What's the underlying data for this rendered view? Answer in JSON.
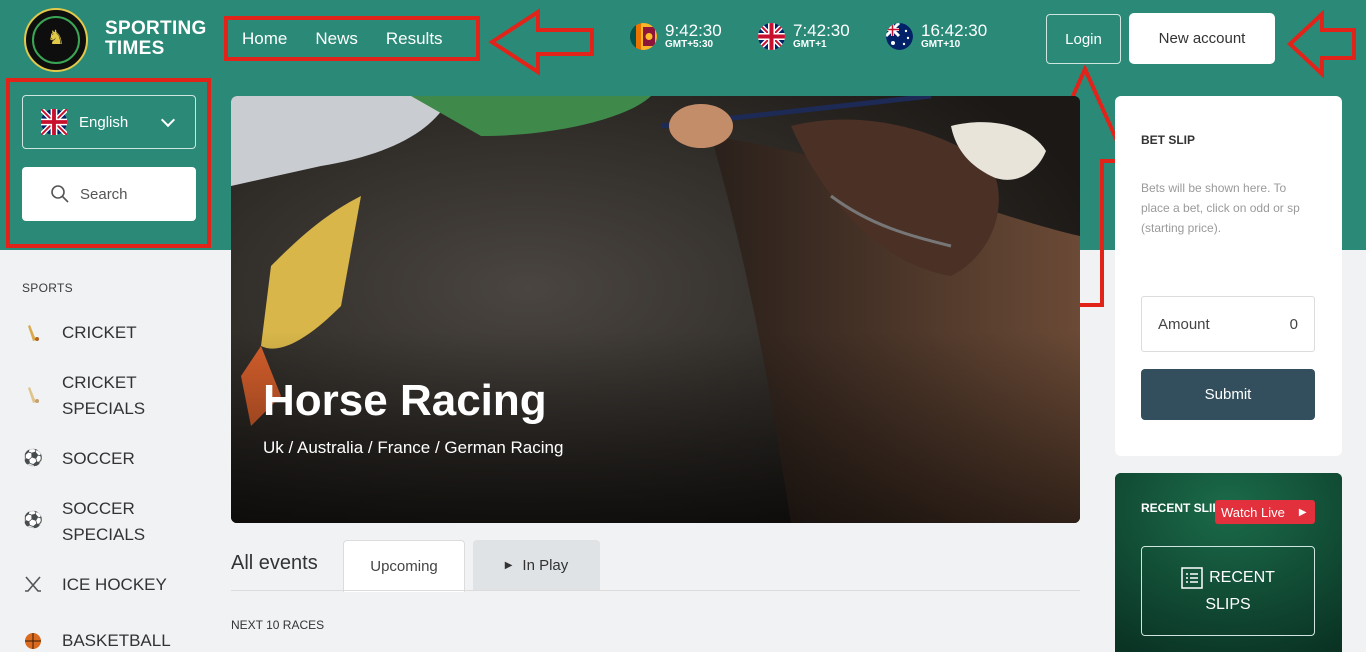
{
  "brand": {
    "line1": "SPORTING",
    "line2": "TIMES",
    "logo_icon": "horse-logo-icon"
  },
  "nav": {
    "items": [
      "Home",
      "News",
      "Results"
    ]
  },
  "clocks": [
    {
      "time": "9:42:30",
      "tz": "GMT+5:30",
      "flag": "sri-lanka-flag-icon"
    },
    {
      "time": "7:42:30",
      "tz": "GMT+1",
      "flag": "uk-flag-icon"
    },
    {
      "time": "16:42:30",
      "tz": "GMT+10",
      "flag": "australia-flag-icon"
    }
  ],
  "header_buttons": {
    "login": "Login",
    "new_account": "New account"
  },
  "language": {
    "selected": "English",
    "flag": "uk-flag-icon"
  },
  "search": {
    "label": "Search"
  },
  "sports": {
    "heading": "SPORTS",
    "items": [
      {
        "line1": "CRICKET",
        "line2": "",
        "icon": "cricket-bat-icon"
      },
      {
        "line1": "CRICKET",
        "line2": "SPECIALS",
        "icon": "cricket-bat-icon"
      },
      {
        "line1": "SOCCER",
        "line2": "",
        "icon": "soccer-ball-icon"
      },
      {
        "line1": "SOCCER",
        "line2": "SPECIALS",
        "icon": "soccer-ball-icon"
      },
      {
        "line1": "ICE HOCKEY",
        "line2": "",
        "icon": "hockey-sticks-icon"
      },
      {
        "line1": "BASKETBALL",
        "line2": "",
        "icon": "basketball-icon"
      }
    ]
  },
  "hero": {
    "title": "Horse Racing",
    "subtitle": "Uk / Australia / France / German Racing"
  },
  "events": {
    "title": "All events",
    "tab_upcoming": "Upcoming",
    "tab_inplay": "In Play",
    "next_races": "NEXT 10 RACES"
  },
  "betslip": {
    "heading": "BET SLIP",
    "note": "Bets will be shown here. To place a bet, click on odd or sp (starting price).",
    "amount_label": "Amount",
    "amount_value": "0",
    "submit": "Submit"
  },
  "recent": {
    "heading": "RECENT SLIPS",
    "watch_live": "Watch Live",
    "button_line1": "RECENT",
    "button_line2": "SLIPS"
  },
  "colors": {
    "header_green": "#2a8a77",
    "annotation_red": "#e2231a",
    "submit_slate": "#334f5e",
    "recent_green": "#0d3f2e",
    "watch_red": "#e2313c"
  }
}
